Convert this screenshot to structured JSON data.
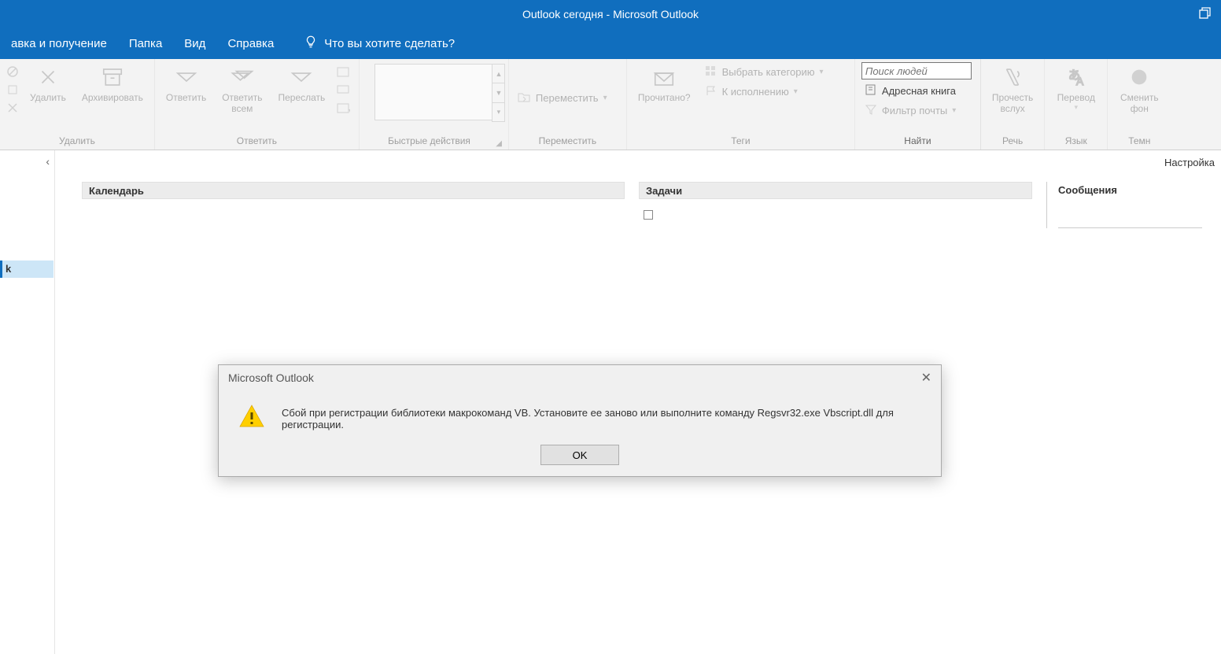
{
  "title": "Outlook сегодня  -  Microsoft Outlook",
  "tabs": {
    "send_receive": "авка и получение",
    "folder": "Папка",
    "view": "Вид",
    "help": "Справка",
    "tellme": "Что вы хотите сделать?"
  },
  "ribbon": {
    "delete_group": "Удалить",
    "delete": "Удалить",
    "archive": "Архивировать",
    "respond_group": "Ответить",
    "reply": "Ответить",
    "reply_all": "Ответить\nвсем",
    "forward": "Переслать",
    "quick_group": "Быстрые действия",
    "move_group": "Переместить",
    "move": "Переместить",
    "tags_group": "Теги",
    "read": "Прочитано?",
    "categorize": "Выбрать категорию",
    "follow_up": "К исполнению",
    "find_group": "Найти",
    "search_placeholder": "Поиск людей",
    "address_book": "Адресная книга",
    "filter": "Фильтр почты",
    "speech_group": "Речь",
    "read_aloud": "Прочесть\nвслух",
    "language_group": "Язык",
    "translate": "Перевод",
    "dark_group": "Темн",
    "dark": "Сменить\nфон"
  },
  "nav": {
    "selected": "k"
  },
  "content": {
    "settings": "Настройка",
    "calendar": "Календарь",
    "tasks": "Задачи",
    "messages": "Сообщения"
  },
  "dialog": {
    "title": "Microsoft Outlook",
    "message": "Сбой при регистрации библиотеки макрокоманд VB. Установите ее заново или выполните команду Regsvr32.exe Vbscript.dll для регистрации.",
    "ok": "OK"
  }
}
